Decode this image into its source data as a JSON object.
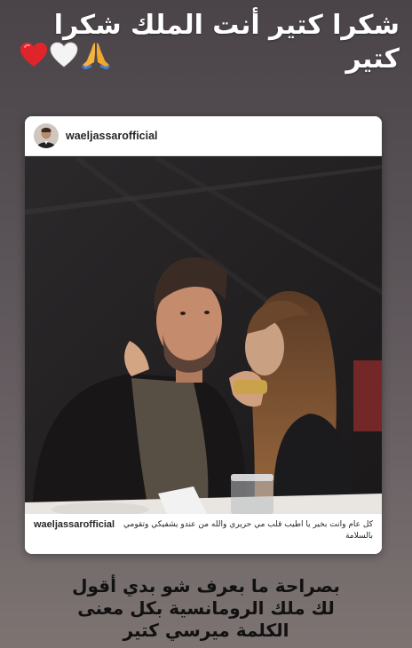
{
  "story": {
    "top_caption": "شكرا كتير أنت الملك شكرا كتير",
    "top_emojis": [
      "red-heart-icon",
      "white-heart-icon",
      "folded-hands-icon"
    ],
    "colors": {
      "red_heart": "#e0242c",
      "white_heart": "#f4f4f4",
      "folded_hands": "#f3b33d"
    }
  },
  "post": {
    "username": "waeljassarofficial",
    "caption_user": "waeljassarofficial",
    "caption_text": "كل عام وانت بخير يا اطيب قلب مي حريري والله من عندو يشفيكي وتقومي بالسلامة"
  },
  "bottom_caption": {
    "line1": "بصراحة ما بعرف شو بدي أقول",
    "line2": "لك ملك الرومانسية بكل معنى",
    "line3": "الكلمة ميرسي كتير"
  }
}
